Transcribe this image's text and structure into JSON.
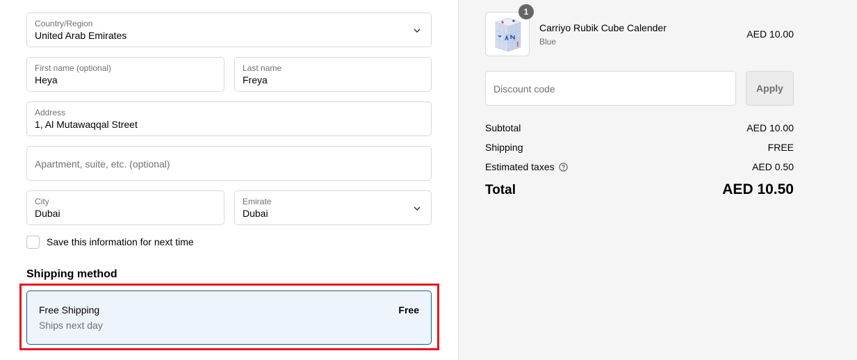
{
  "form": {
    "country": {
      "label": "Country/Region",
      "value": "United Arab Emirates"
    },
    "first_name": {
      "label": "First name (optional)",
      "value": "Heya"
    },
    "last_name": {
      "label": "Last name",
      "value": "Freya"
    },
    "address": {
      "label": "Address",
      "value": "1, Al Mutawaqqal Street"
    },
    "apartment": {
      "placeholder": "Apartment, suite, etc. (optional)"
    },
    "city": {
      "label": "City",
      "value": "Dubai"
    },
    "emirate": {
      "label": "Emirate",
      "value": "Dubai"
    },
    "save_info_label": "Save this information for next time"
  },
  "shipping": {
    "title": "Shipping method",
    "option": {
      "name": "Free Shipping",
      "subtitle": "Ships next day",
      "price": "Free"
    }
  },
  "summary": {
    "item": {
      "quantity": "1",
      "name": "Carriyo Rubik Cube Calender",
      "variant": "Blue",
      "price": "AED 10.00",
      "image_icon": "rubik-cube-calendar-image"
    },
    "discount_placeholder": "Discount code",
    "apply_label": "Apply",
    "subtotal_label": "Subtotal",
    "subtotal_value": "AED 10.00",
    "shipping_label": "Shipping",
    "shipping_value": "FREE",
    "taxes_label": "Estimated taxes",
    "taxes_value": "AED 0.50",
    "total_label": "Total",
    "total_value": "AED 10.50"
  },
  "colors": {
    "highlight": "#e8141f",
    "selected_border": "#1a5c80",
    "selected_bg": "#eef4fb"
  }
}
